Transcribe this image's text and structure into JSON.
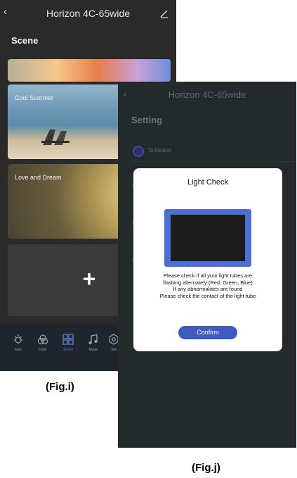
{
  "fig_i": {
    "header": {
      "back_icon": "chevron-left-icon",
      "title": "Horizon 4C-65wide",
      "edit_icon": "pencil-icon"
    },
    "section_title": "Scene",
    "scenes": [
      {
        "label": ""
      },
      {
        "label": "Cool Summer"
      },
      {
        "label": "Love and Dream"
      }
    ],
    "add_scene": "+",
    "tabs": [
      {
        "label": "Sync",
        "icon": "sync-icon"
      },
      {
        "label": "Color",
        "icon": "color-icon"
      },
      {
        "label": "Scene",
        "icon": "scene-icon"
      },
      {
        "label": "Music",
        "icon": "music-icon"
      },
      {
        "label": "Set",
        "icon": "settings-icon"
      }
    ],
    "active_tab": "Scene",
    "caption": "(Fig.i)"
  },
  "fig_j": {
    "header": {
      "back_icon": "chevron-left-icon",
      "title": "Horizon 4C-65wide"
    },
    "section_title": "Setting",
    "schedule_label": "Schedule",
    "dialog": {
      "title": "Light Check",
      "message_lines": [
        "Please check if all your light tubes are",
        "flashing alternately (Red, Green, Blue)",
        "If any abnormalities are found",
        "Please check the contact of the light tube"
      ],
      "confirm": "Confirm"
    },
    "caption": "(Fig.j)"
  },
  "colors": {
    "accent": "#3f5bbf",
    "tab_active": "#5b84e0",
    "monitor_frame": "#4a6fd0"
  }
}
